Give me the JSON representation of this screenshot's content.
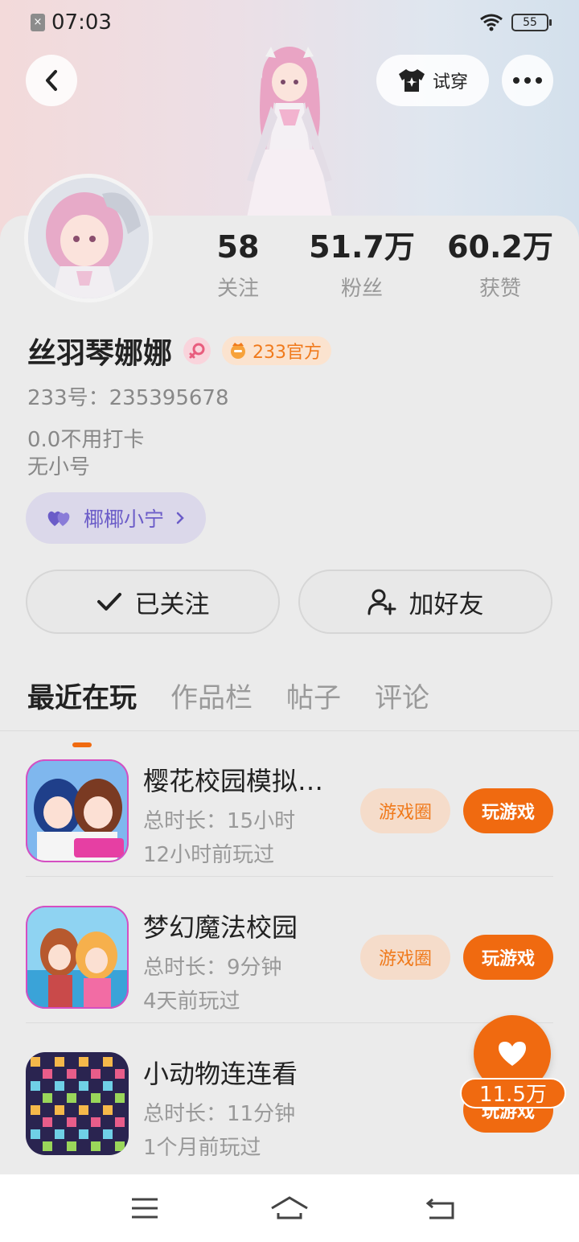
{
  "status_bar": {
    "time": "07:03",
    "battery": "55"
  },
  "header": {
    "tryon_label": "试穿"
  },
  "profile": {
    "name": "丝羽琴娜娜",
    "official_badge": "233官方",
    "id_line": "233号：235395678",
    "bio_line1": "0.0不用打卡",
    "bio_line2": "无小号",
    "friend_tag": "椰椰小宁"
  },
  "stats": [
    {
      "value": "58",
      "label": "关注"
    },
    {
      "value": "51.7万",
      "label": "粉丝"
    },
    {
      "value": "60.2万",
      "label": "获赞"
    }
  ],
  "actions": {
    "follow_label": "已关注",
    "add_friend_label": "加好友"
  },
  "tabs": [
    "最近在玩",
    "作品栏",
    "帖子",
    "评论"
  ],
  "games": [
    {
      "title": "樱花校园模拟…",
      "duration": "总时长：15小时",
      "last_played": "12小时前玩过",
      "circle_label": "游戏圈",
      "play_label": "玩游戏"
    },
    {
      "title": "梦幻魔法校园",
      "duration": "总时长：9分钟",
      "last_played": "4天前玩过",
      "circle_label": "游戏圈",
      "play_label": "玩游戏"
    },
    {
      "title": "小动物连连看",
      "duration": "总时长：11分钟",
      "last_played": "1个月前玩过",
      "circle_label": "",
      "play_label": "玩游戏"
    }
  ],
  "fab": {
    "like_count": "11.5万"
  },
  "colors": {
    "accent": "#f06a10",
    "friend_tag": "#6b5cc8"
  }
}
